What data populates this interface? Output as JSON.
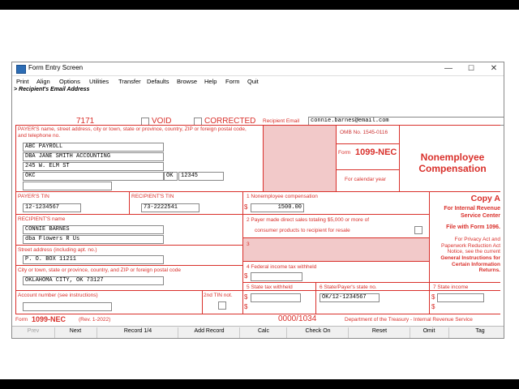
{
  "window": {
    "title": "Form Entry Screen",
    "minimize": "—",
    "maximize": "☐",
    "close": "✕"
  },
  "menu": [
    "Print",
    "Align",
    "Options",
    "Utilities",
    "Transfer",
    "Defaults",
    "Browse",
    "Help",
    "Form",
    "Quit"
  ],
  "path": "> Recipient's Email Address",
  "form": {
    "number_top": "7171",
    "void_label": "VOID",
    "corrected_label": "CORRECTED",
    "recipient_email_label": "Recipient Email",
    "recipient_email": "connie.barnes@email.com",
    "payer_block_label": "PAYER'S name, street address, city or town, state or province, country, ZIP or foreign postal code, and telephone no.",
    "payer_name": "ABC PAYROLL",
    "payer_name2": "DBA JANE SMITH ACCOUNTING",
    "payer_street": "245 W. ELM ST",
    "payer_city": "OKC",
    "payer_state": "OK",
    "payer_zip": "12345",
    "payer_phone": "",
    "omb": "OMB No. 1545-0116",
    "form_word": "Form",
    "form_name": "1099-NEC",
    "calendar_year": "For calendar year",
    "title_line1": "Nonemployee",
    "title_line2": "Compensation",
    "payer_tin_label": "PAYER'S TIN",
    "payer_tin": "12-1234567",
    "recipient_tin_label": "RECIPIENT'S TIN",
    "recipient_tin": "73-2222541",
    "box1_label": "1  Nonemployee compensation",
    "box1_value": "1500.00",
    "recipient_name_label": "RECIPIENT'S name",
    "recipient_name": "CONNIE BARNES",
    "recipient_name2": "dba Flowers R Us",
    "box2_label_line1": "2  Payer made direct sales totaling $5,000 or more of",
    "box2_label_line2": "consumer products to recipient for resale",
    "box3_label": "3",
    "street_label": "Street address (including apt. no.)",
    "street_value": "P. O. BOX 11211",
    "box4_label": "4  Federal income tax withheld",
    "box4_value": "",
    "city_label": "City or town, state or province, country, and ZIP or foreign postal code",
    "city_value": "OKLAHOMA CITY, OK 73127",
    "copy_title": "Copy A",
    "copy_line1": "For Internal Revenue",
    "copy_line2": "Service Center",
    "copy_line3": "File with Form 1096.",
    "copy_note": "For Privacy Act and Paperwork Reduction Act Notice, see the current",
    "copy_note_bold": "General Instructions for Certain Information Returns.",
    "account_label": "Account number (see instructions)",
    "account_value": "",
    "second_tin_label": "2nd TIN not.",
    "box5_label": "5  State tax withheld",
    "box6_label": "6  State/Payer's state no.",
    "box6_value": "OK/12-1234567",
    "box7_label": "7  State income",
    "dollar": "$",
    "footer_form": "Form",
    "footer_form_name": "1099-NEC",
    "footer_rev": "(Rev. 1-2022)",
    "footer_counter": "0000/1034",
    "footer_dept": "Department of the Treasury - Internal Revenue Service"
  },
  "buttons": {
    "prev": "Prev",
    "next": "Next",
    "record": "Record  1/4",
    "add_record": "Add Record",
    "calc": "Calc",
    "check_on": "Check On",
    "reset": "Reset",
    "omit": "Omit",
    "tag": "Tag"
  },
  "colors": {
    "form_red": "#d9302b",
    "shade_pink": "#f2c9c9",
    "title_blue": "#2d6db5"
  }
}
